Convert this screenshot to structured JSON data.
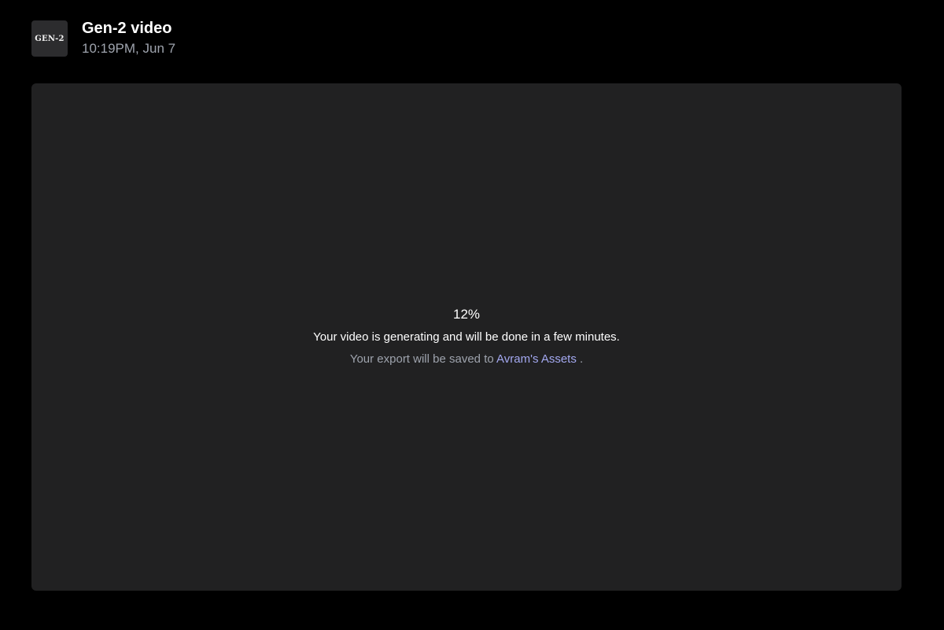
{
  "header": {
    "thumbnail_label": "GEN-2",
    "title": "Gen-2 video",
    "timestamp": "10:19PM, Jun 7"
  },
  "status": {
    "progress_percent": 12,
    "progress_label": "12%",
    "message": "Your video is generating and will be done in a few minutes.",
    "export_prefix": "Your export will be saved to",
    "export_location": "Avram's Assets",
    "export_suffix": "."
  },
  "colors": {
    "background": "#000000",
    "panel": "#212122",
    "muted_text": "#9ea3ad",
    "link": "#a3a8f0"
  }
}
